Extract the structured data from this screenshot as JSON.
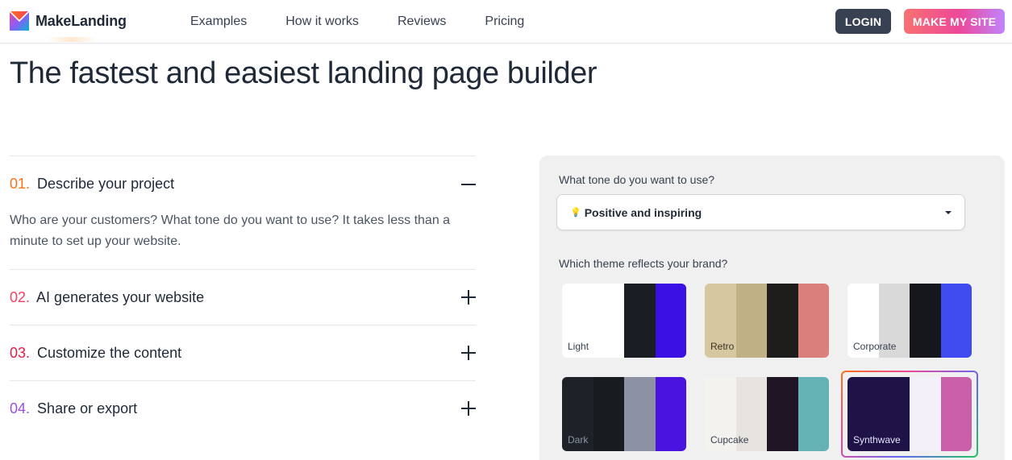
{
  "header": {
    "brand": "MakeLanding",
    "nav": [
      "Examples",
      "How it works",
      "Reviews",
      "Pricing"
    ],
    "login_label": "LOGIN",
    "cta_label": "MAKE MY SITE"
  },
  "hero": {
    "title": "The fastest and easiest landing page builder"
  },
  "steps": [
    {
      "num": "01.",
      "title": "Describe your project",
      "body": "Who are your customers? What tone do you want to use? It takes less than a minute to set up your website.",
      "open": true,
      "num_color": "#f97316"
    },
    {
      "num": "02.",
      "title": "AI generates your website",
      "open": false,
      "num_color": "#f43f5e"
    },
    {
      "num": "03.",
      "title": "Customize the content",
      "open": false,
      "num_color": "#e11d48"
    },
    {
      "num": "04.",
      "title": "Share or export",
      "open": false,
      "num_color": "#9d4edd"
    }
  ],
  "panel": {
    "tone_label": "What tone do you want to use?",
    "tone_emoji": "💡",
    "tone_value": "Positive and inspiring",
    "theme_label": "Which theme reflects your brand?",
    "themes": [
      {
        "name": "Light",
        "colors": [
          "#ffffff",
          "#ffffff",
          "#1a1d23",
          "#3a10e5"
        ],
        "text_color": "#374151"
      },
      {
        "name": "Retro",
        "colors": [
          "#d6c7a0",
          "#bfb086",
          "#1f1d1b",
          "#db7f7a"
        ],
        "text_color": "#3a3326"
      },
      {
        "name": "Corporate",
        "colors": [
          "#ffffff",
          "#d9d9d9",
          "#15171c",
          "#3f4bef"
        ],
        "text_color": "#374151"
      },
      {
        "name": "Dark",
        "colors": [
          "#1d2128",
          "#181b20",
          "#8c92a3",
          "#4a13e0"
        ],
        "text_color": "#8c92a3"
      },
      {
        "name": "Cupcake",
        "colors": [
          "#f4f2ef",
          "#e7e3df",
          "#1f1424",
          "#65b2b5"
        ],
        "text_color": "#374151"
      },
      {
        "name": "Synthwave",
        "colors": [
          "#1e1247",
          "#1e1247",
          "#f4f0fa",
          "#c95fa8"
        ],
        "text_color": "#e9e4ff",
        "selected": true
      }
    ]
  }
}
